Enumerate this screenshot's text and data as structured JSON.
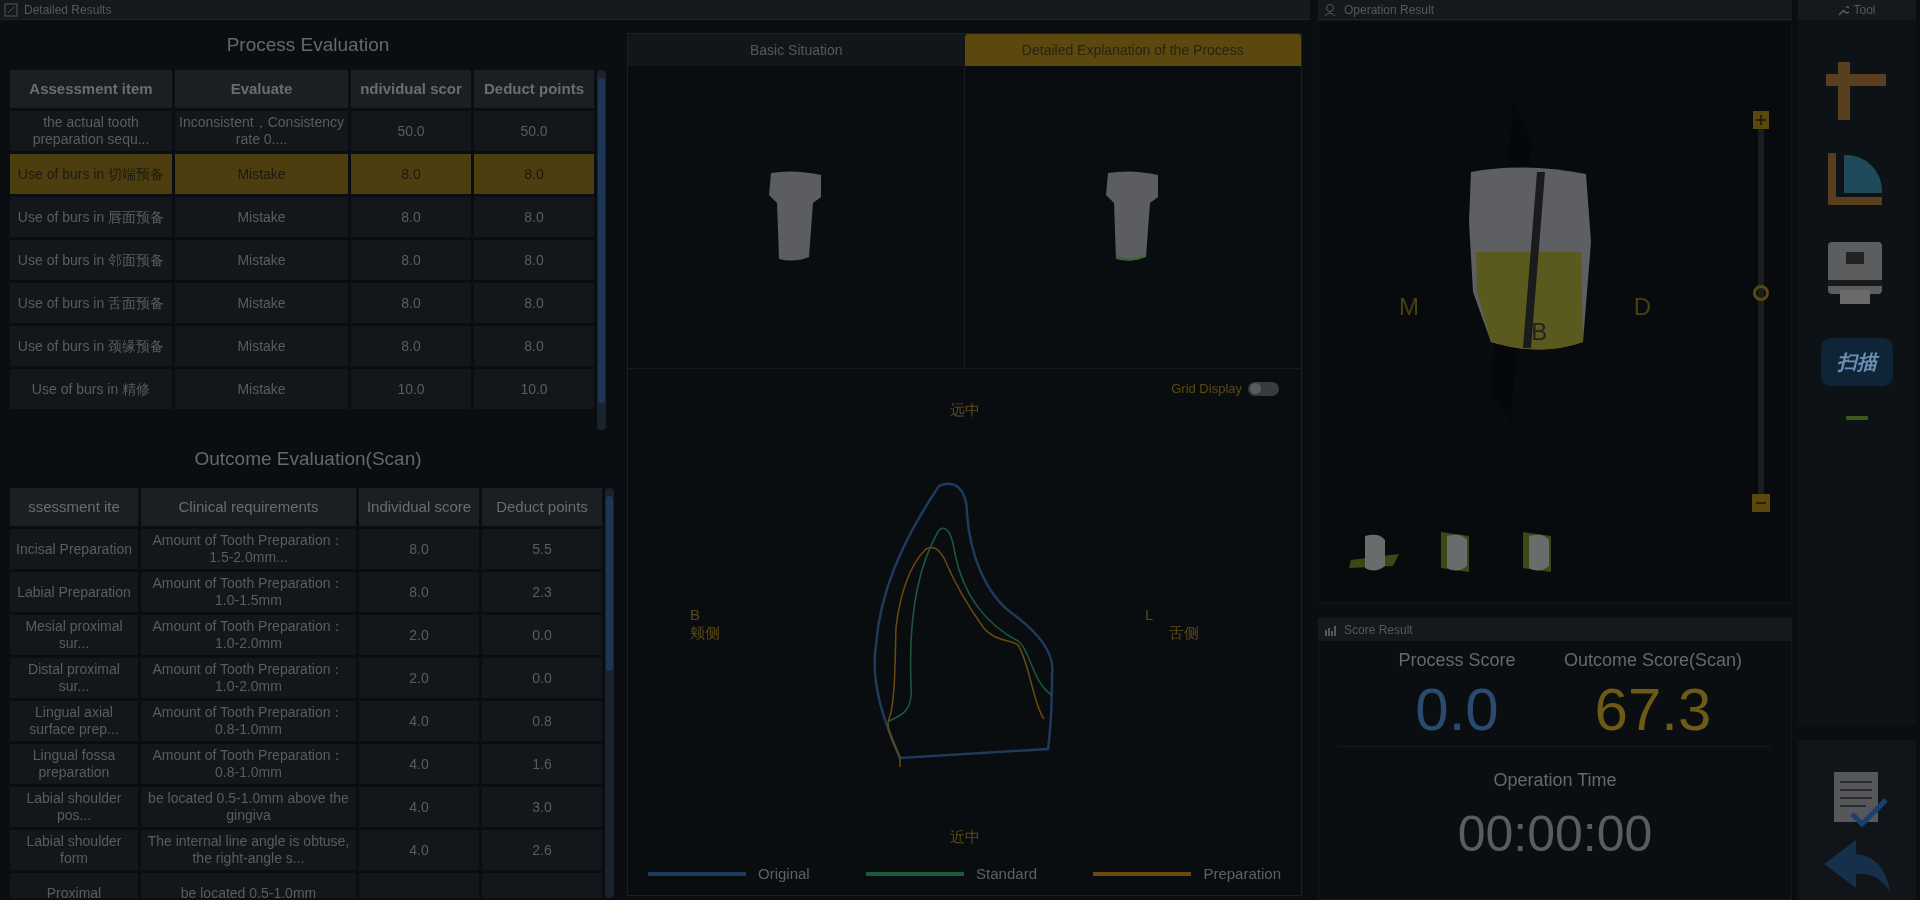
{
  "header": {
    "title": "Detailed Results"
  },
  "process_evaluation": {
    "title": "Process Evaluation",
    "columns": [
      "Assessment item",
      "Evaluate",
      "ndividual scor",
      "Deduct points"
    ],
    "rows": [
      {
        "cells": [
          "the actual tooth preparation sequ...",
          "Inconsistent，Consistency rate 0....",
          "50.0",
          "50.0"
        ],
        "selected": false
      },
      {
        "cells": [
          "Use of burs in 切端预备",
          "Mistake",
          "8.0",
          "8.0"
        ],
        "selected": true
      },
      {
        "cells": [
          "Use of burs in 唇面预备",
          "Mistake",
          "8.0",
          "8.0"
        ],
        "selected": false
      },
      {
        "cells": [
          "Use of burs in 邻面预备",
          "Mistake",
          "8.0",
          "8.0"
        ],
        "selected": false
      },
      {
        "cells": [
          "Use of burs in 舌面预备",
          "Mistake",
          "8.0",
          "8.0"
        ],
        "selected": false
      },
      {
        "cells": [
          "Use of burs in 颈缘预备",
          "Mistake",
          "8.0",
          "8.0"
        ],
        "selected": false
      },
      {
        "cells": [
          "Use of burs in 精修",
          "Mistake",
          "10.0",
          "10.0"
        ],
        "selected": false
      }
    ]
  },
  "outcome_evaluation": {
    "title": "Outcome Evaluation(Scan)",
    "columns": [
      "ssessment ite",
      "Clinical requirements",
      "Individual score",
      "Deduct points"
    ],
    "rows": [
      {
        "cells": [
          "Incisal Preparation",
          "Amount of Tooth Preparation：1.5-2.0mm...",
          "8.0",
          "5.5"
        ]
      },
      {
        "cells": [
          "Labial Preparation",
          "Amount of Tooth Preparation：1.0-1.5mm",
          "8.0",
          "2.3"
        ]
      },
      {
        "cells": [
          "Mesial proximal sur...",
          "Amount of Tooth Preparation：1.0-2.0mm",
          "2.0",
          "0.0"
        ]
      },
      {
        "cells": [
          "Distal proximal sur...",
          "Amount of Tooth Preparation：1.0-2.0mm",
          "2.0",
          "0.0"
        ]
      },
      {
        "cells": [
          "Lingual axial surface prep...",
          "Amount of Tooth Preparation：0.8-1.0mm",
          "4.0",
          "0.8"
        ]
      },
      {
        "cells": [
          "Lingual fossa preparation",
          "Amount of Tooth Preparation：0.8-1.0mm",
          "4.0",
          "1.6"
        ]
      },
      {
        "cells": [
          "Labial shoulder pos...",
          "be located 0.5-1.0mm above the gingiva",
          "4.0",
          "3.0"
        ]
      },
      {
        "cells": [
          "Labial shoulder form",
          "The internal line angle is obtuse, the right-angle s...",
          "4.0",
          "2.6"
        ]
      },
      {
        "cells": [
          "Proximal",
          "be located 0.5-1.0mm"
        ]
      }
    ]
  },
  "view_tabs": [
    {
      "label": "Basic Situation",
      "selected": false
    },
    {
      "label": "Detailed Explanation of the Process",
      "selected": true
    }
  ],
  "section_view": {
    "grid_display": {
      "label": "Grid Display",
      "on": false
    },
    "top": "远中",
    "bottom": "近中",
    "left_letter": "B",
    "left": "颊侧",
    "right_letter": "L",
    "right": "舌侧",
    "legend": [
      {
        "label": "Original",
        "color": "#1f3a5c"
      },
      {
        "label": "Standard",
        "color": "#1d5a3c"
      },
      {
        "label": "Preparation",
        "color": "#6b4a12"
      }
    ]
  },
  "operation_result": {
    "title": "Operation Result",
    "labels": [
      "M",
      "B",
      "D"
    ],
    "zoom_slider": {
      "level": 0.55
    }
  },
  "tool": {
    "title": "Tool",
    "scan_label": "扫描"
  },
  "score_result": {
    "title": "Score Result",
    "process_label": "Process Score",
    "process_score": "0.0",
    "outcome_label": "Outcome Score(Scan)",
    "outcome_score": "67.3",
    "time_label": "Operation Time",
    "time": "00:00:00"
  }
}
